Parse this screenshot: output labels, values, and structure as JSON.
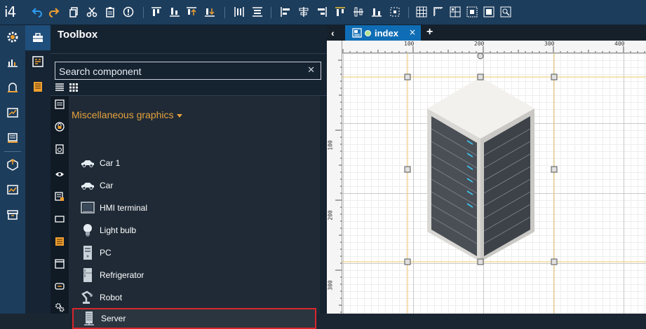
{
  "app": {
    "logo": "i4"
  },
  "toolbox": {
    "title": "Toolbox",
    "search_placeholder": "Search component",
    "search_value": "",
    "clear_glyph": "✕",
    "group_label": "Miscellaneous graphics",
    "items": [
      {
        "label": "Car 1",
        "icon": "car-icon"
      },
      {
        "label": "Car",
        "icon": "car-icon"
      },
      {
        "label": "HMI terminal",
        "icon": "hmi-terminal-icon"
      },
      {
        "label": "Light bulb",
        "icon": "light-bulb-icon"
      },
      {
        "label": "PC",
        "icon": "pc-icon"
      },
      {
        "label": "Refrigerator",
        "icon": "refrigerator-icon"
      },
      {
        "label": "Robot",
        "icon": "robot-icon"
      },
      {
        "label": "Server",
        "icon": "server-icon",
        "selected": true
      }
    ]
  },
  "editor": {
    "back_glyph": "‹",
    "tab_label": "index",
    "tab_close": "×",
    "tab_add": "+",
    "ruler_top": [
      "100",
      "200",
      "300",
      "400"
    ],
    "ruler_left": [
      "100",
      "200",
      "300"
    ]
  },
  "colors": {
    "accent_blue": "#0f6db5",
    "group_orange": "#e6a23c",
    "selection_red": "#d9262c",
    "guide_yellow": "#f0c96a"
  }
}
